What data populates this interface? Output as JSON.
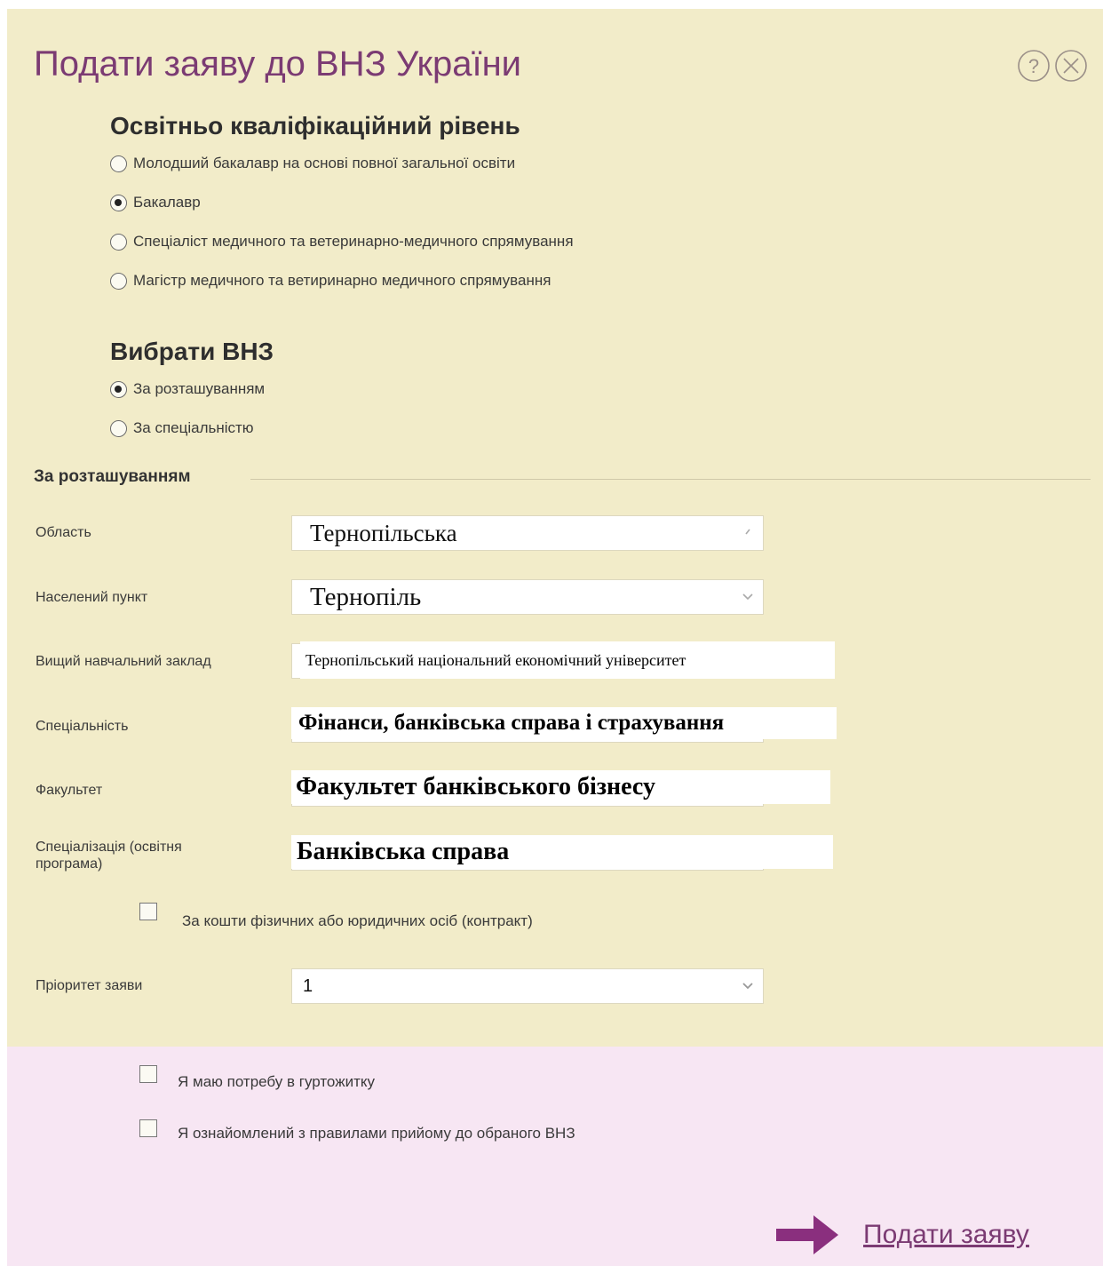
{
  "dialog": {
    "title": "Подати заяву до ВНЗ України",
    "help_icon": "help-icon",
    "close_icon": "close-icon",
    "colors": {
      "title": "#7b3b73",
      "background": "#f2ecc9",
      "footer_background": "#f7e6f3"
    }
  },
  "education_level": {
    "heading": "Освітньо кваліфікаційний рівень",
    "options": [
      {
        "label": "Молодший бакалавр на основі повної загальної освіти",
        "selected": false
      },
      {
        "label": "Бакалавр",
        "selected": true
      },
      {
        "label": "Спеціаліст медичного та ветеринарно-медичного спрямування",
        "selected": false
      },
      {
        "label": "Магістр медичного та ветиринарно медичного спрямування",
        "selected": false
      }
    ]
  },
  "choose_university": {
    "heading": "Вибрати ВНЗ",
    "options": [
      {
        "label": "За розташуванням",
        "selected": true
      },
      {
        "label": "За спеціальністю",
        "selected": false
      }
    ]
  },
  "location_section": {
    "title": "За розташуванням",
    "fields": [
      {
        "label": "Область",
        "value": "Тернопільська"
      },
      {
        "label": "Населений пункт",
        "value": "Тернопіль"
      },
      {
        "label": "Вищий навчальний заклад",
        "value": "Тернопільський національний економічний університет"
      },
      {
        "label": "Спеціальність",
        "value": "Фінанси, банківська справа і страхування"
      },
      {
        "label": "Факультет",
        "value": "Факультет банківського бізнесу"
      },
      {
        "label": "Спеціалізація (освітня програма)",
        "value": "Банківська справа"
      }
    ],
    "contract_checkbox": {
      "label": "За кошти фізичних або юридичних осіб (контракт)",
      "checked": false
    },
    "priority": {
      "label": "Пріоритет заяви",
      "value": "1"
    }
  },
  "footer": {
    "dormitory": {
      "label": "Я маю потребу в гуртожитку",
      "checked": false
    },
    "rules": {
      "label": "Я ознайомлений з правилами прийому до обраного ВНЗ",
      "checked": false
    },
    "submit_label": "Подати заяву",
    "submit_icon": "arrow-right-icon"
  }
}
